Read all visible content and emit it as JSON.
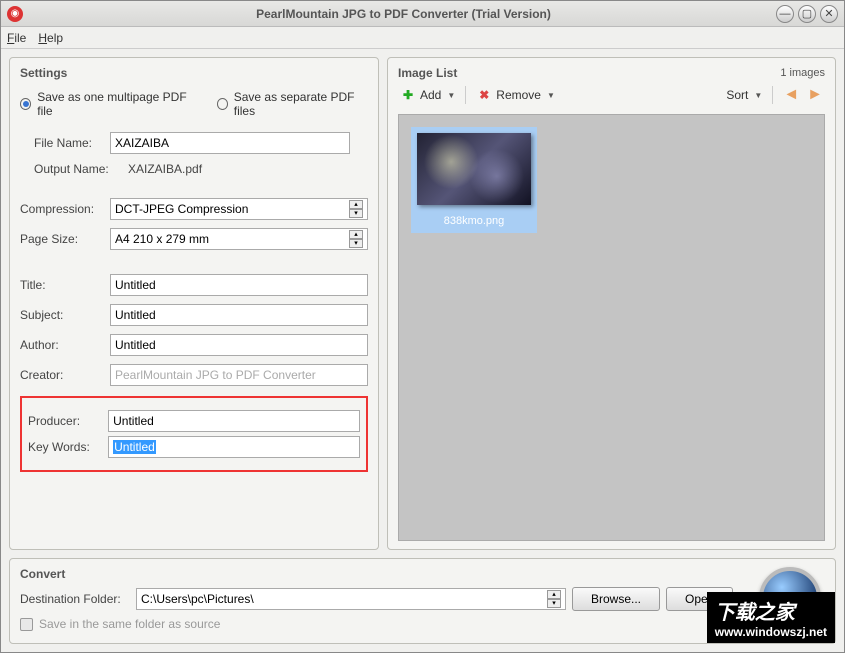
{
  "titlebar": {
    "title": "PearlMountain JPG to PDF Converter (Trial Version)"
  },
  "menu": {
    "file": "File",
    "help": "Help"
  },
  "settings": {
    "title": "Settings",
    "save_multipage": "Save as one multipage PDF file",
    "save_separate": "Save as separate PDF files",
    "filename_label": "File Name:",
    "filename": "XAIZAIBA",
    "outputname_label": "Output Name:",
    "outputname": "XAIZAIBA.pdf",
    "compression_label": "Compression:",
    "compression": "DCT-JPEG Compression",
    "pagesize_label": "Page Size:",
    "pagesize": "A4 210 x 279 mm",
    "title_label": "Title:",
    "title_val": "Untitled",
    "subject_label": "Subject:",
    "subject": "Untitled",
    "author_label": "Author:",
    "author": "Untitled",
    "creator_label": "Creator:",
    "creator": "PearlMountain JPG to PDF Converter",
    "producer_label": "Producer:",
    "producer": "Untitled",
    "keywords_label": "Key Words:",
    "keywords": "Untitled"
  },
  "imagelist": {
    "title": "Image List",
    "count": "1 images",
    "add": "Add",
    "remove": "Remove",
    "sort": "Sort",
    "thumb_name": "838kmo.png"
  },
  "convert": {
    "title": "Convert",
    "dest_label": "Destination Folder:",
    "dest": "C:\\Users\\pc\\Pictures\\",
    "browse": "Browse...",
    "open": "Open",
    "same_folder": "Save in the same folder as source"
  },
  "watermark": {
    "big": "下载之家",
    "url": "www.windowszj.net"
  }
}
